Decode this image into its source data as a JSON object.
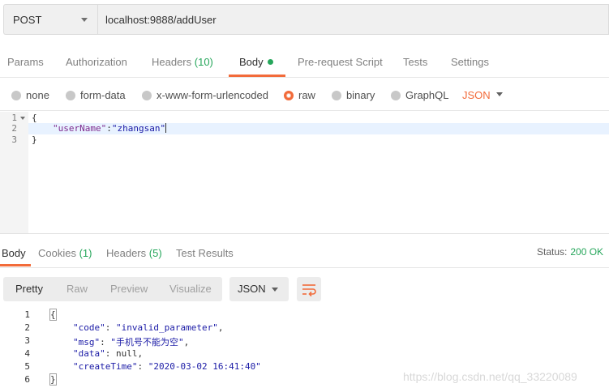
{
  "request": {
    "method": "POST",
    "url": "localhost:9888/addUser"
  },
  "request_tabs": [
    {
      "label": "Params"
    },
    {
      "label": "Authorization"
    },
    {
      "label": "Headers",
      "count": "(10)"
    },
    {
      "label": "Body",
      "active": true,
      "has_dot": true
    },
    {
      "label": "Pre-request Script"
    },
    {
      "label": "Tests"
    },
    {
      "label": "Settings"
    }
  ],
  "body_types": [
    {
      "label": "none"
    },
    {
      "label": "form-data"
    },
    {
      "label": "x-www-form-urlencoded"
    },
    {
      "label": "raw",
      "selected": true
    },
    {
      "label": "binary"
    },
    {
      "label": "GraphQL"
    }
  ],
  "body_language": "JSON",
  "request_body": {
    "line_numbers": [
      "1",
      "2",
      "3"
    ],
    "line1": "{",
    "key": "\"userName\"",
    "colon": ":",
    "value": "\"zhangsan\"",
    "line3": "}"
  },
  "response_tabs": {
    "body": "Body",
    "cookies": "Cookies",
    "cookies_count": "(1)",
    "headers": "Headers",
    "headers_count": "(5)",
    "test_results": "Test Results"
  },
  "status": {
    "label": "Status:",
    "value": "200 OK"
  },
  "response_view": {
    "modes": [
      "Pretty",
      "Raw",
      "Preview",
      "Visualize"
    ],
    "active_mode": "Pretty",
    "format": "JSON",
    "wrap_icon": "wrap-lines-icon"
  },
  "response_body": {
    "line_numbers": [
      "1",
      "2",
      "3",
      "4",
      "5",
      "6"
    ],
    "open": "{",
    "lines": [
      {
        "key": "\"code\"",
        "value": "\"invalid_parameter\"",
        "comma": ","
      },
      {
        "key": "\"msg\"",
        "value": "\"手机号不能为空\"",
        "comma": ","
      },
      {
        "key": "\"data\"",
        "value": "null",
        "comma": ","
      },
      {
        "key": "\"createTime\"",
        "value": "\"2020-03-02 16:41:40\"",
        "comma": ""
      }
    ],
    "close": "}"
  },
  "watermark": "https://blog.csdn.net/qq_33220089",
  "colors": {
    "accent": "#f26b3a",
    "success": "#26a65b"
  }
}
